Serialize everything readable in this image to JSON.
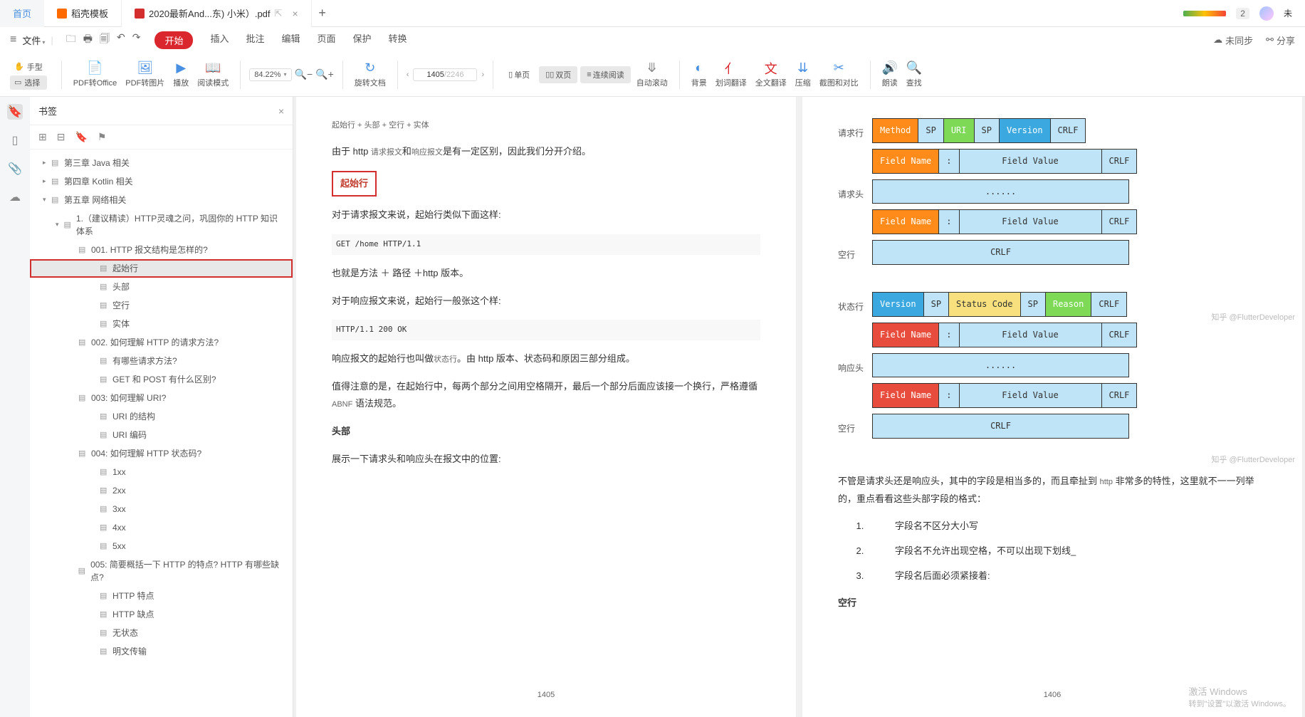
{
  "titlebar": {
    "home": "首页",
    "tab_template": "稻壳模板",
    "tab_pdf": "2020最新And...东) 小米）.pdf",
    "limit_badge": "2",
    "user_label": "未"
  },
  "menu": {
    "file": "文件",
    "tabs": [
      "开始",
      "插入",
      "批注",
      "编辑",
      "页面",
      "保护",
      "转换"
    ],
    "sync": "未同步",
    "share": "分享"
  },
  "toolbar": {
    "hand": "手型",
    "select": "选择",
    "pdf_office": "PDF转Office",
    "pdf_img": "PDF转图片",
    "play": "播放",
    "read_mode": "阅读模式",
    "zoom": "84.22%",
    "rotate": "旋转文档",
    "page_cur": "1405",
    "page_total": "/2246",
    "single": "单页",
    "double": "双页",
    "continuous": "连续阅读",
    "auto_scroll": "自动滚动",
    "bg": "背景",
    "dict": "划词翻译",
    "full_trans": "全文翻译",
    "compress": "压缩",
    "crop": "截图和对比",
    "read_aloud": "朗读",
    "find": "查找"
  },
  "bookmarks": {
    "title": "书签",
    "items": [
      {
        "lvl": 1,
        "caret": "▸",
        "txt": "第三章 Java 相关"
      },
      {
        "lvl": 1,
        "caret": "▸",
        "txt": "第四章 Kotlin 相关"
      },
      {
        "lvl": 1,
        "caret": "▾",
        "txt": "第五章 网络相关"
      },
      {
        "lvl": 2,
        "caret": "▾",
        "txt": "1.（建议精读）HTTP灵魂之问，巩固你的 HTTP 知识体系"
      },
      {
        "lvl": 3,
        "caret": "",
        "txt": "001. HTTP 报文结构是怎样的?"
      },
      {
        "lvl": 4,
        "caret": "",
        "txt": "起始行",
        "sel": true
      },
      {
        "lvl": 4,
        "caret": "",
        "txt": "头部"
      },
      {
        "lvl": 4,
        "caret": "",
        "txt": "空行"
      },
      {
        "lvl": 4,
        "caret": "",
        "txt": "实体"
      },
      {
        "lvl": 3,
        "caret": "",
        "txt": "002. 如何理解 HTTP 的请求方法?"
      },
      {
        "lvl": 4,
        "caret": "",
        "txt": "有哪些请求方法?"
      },
      {
        "lvl": 4,
        "caret": "",
        "txt": "GET 和 POST 有什么区别?"
      },
      {
        "lvl": 3,
        "caret": "",
        "txt": "003: 如何理解 URI?"
      },
      {
        "lvl": 4,
        "caret": "",
        "txt": "URI 的结构"
      },
      {
        "lvl": 4,
        "caret": "",
        "txt": "URI 编码"
      },
      {
        "lvl": 3,
        "caret": "",
        "txt": "004: 如何理解 HTTP 状态码?"
      },
      {
        "lvl": 4,
        "caret": "",
        "txt": "1xx"
      },
      {
        "lvl": 4,
        "caret": "",
        "txt": "2xx"
      },
      {
        "lvl": 4,
        "caret": "",
        "txt": "3xx"
      },
      {
        "lvl": 4,
        "caret": "",
        "txt": "4xx"
      },
      {
        "lvl": 4,
        "caret": "",
        "txt": "5xx"
      },
      {
        "lvl": 3,
        "caret": "",
        "txt": "005: 简要概括一下 HTTP 的特点? HTTP 有哪些缺点?"
      },
      {
        "lvl": 4,
        "caret": "",
        "txt": "HTTP 特点"
      },
      {
        "lvl": 4,
        "caret": "",
        "txt": "HTTP 缺点"
      },
      {
        "lvl": 4,
        "caret": "",
        "txt": "无状态"
      },
      {
        "lvl": 4,
        "caret": "",
        "txt": "明文传输"
      }
    ]
  },
  "page_left": {
    "line0": "起始行 + 头部 + 空行 + 实体",
    "line1a": "由于 http ",
    "line1b": "请求报文",
    "line1c": "和",
    "line1d": "响应报文",
    "line1e": "是有一定区别，因此我们分开介绍。",
    "heading": "起始行",
    "line2": "对于请求报文来说，起始行类似下面这样:",
    "code1": "GET /home HTTP/1.1",
    "line3": "也就是方法 ＋ 路径 ＋http 版本。",
    "line4": "对于响应报文来说，起始行一般张这个样:",
    "code2": "HTTP/1.1 200 OK",
    "line5a": "响应报文的起始行也叫做",
    "line5b": "状态行",
    "line5c": "。由 http 版本、状态码和原因三部分组成。",
    "line6a": "值得注意的是，在起始行中，每两个部分之间用空格隔开，最后一个部分后面应该接一个换行，严格遵循 ",
    "line6b": "ABNF",
    "line6c": " 语法规范。",
    "heading2": "头部",
    "line7": "展示一下请求头和响应头在报文中的位置:",
    "pagenum": "1405"
  },
  "page_right": {
    "labels": {
      "req_line": "请求行",
      "req_head": "请求头",
      "blank": "空行",
      "status_line": "状态行",
      "resp_head": "响应头"
    },
    "tbl1": {
      "method": "Method",
      "sp": "SP",
      "uri": "URI",
      "version": "Version",
      "crlf": "CRLF",
      "field_name": "Field Name",
      "colon": ":",
      "field_value": "Field Value",
      "dots": "......"
    },
    "tbl2": {
      "version": "Version",
      "sp": "SP",
      "status": "Status Code",
      "reason": "Reason",
      "crlf": "CRLF",
      "field_name": "Field Name",
      "colon": ":",
      "field_value": "Field Value",
      "dots": "......"
    },
    "watermark": "知乎 @FlutterDeveloper",
    "para1a": "不管是请求头还是响应头，其中的字段是相当多的，而且牵扯到 ",
    "para1b": "http",
    "para1c": " 非常多的特性，这里就不一一列举的，重点看看这些头部字段的格式：",
    "list": [
      "字段名不区分大小写",
      "字段名不允许出现空格，不可以出现下划线_",
      "字段名后面必须紧接着:"
    ],
    "heading_blank": "空行",
    "pagenum": "1406"
  },
  "win": {
    "l1": "激活 Windows",
    "l2": "转到\"设置\"以激活 Windows。"
  }
}
